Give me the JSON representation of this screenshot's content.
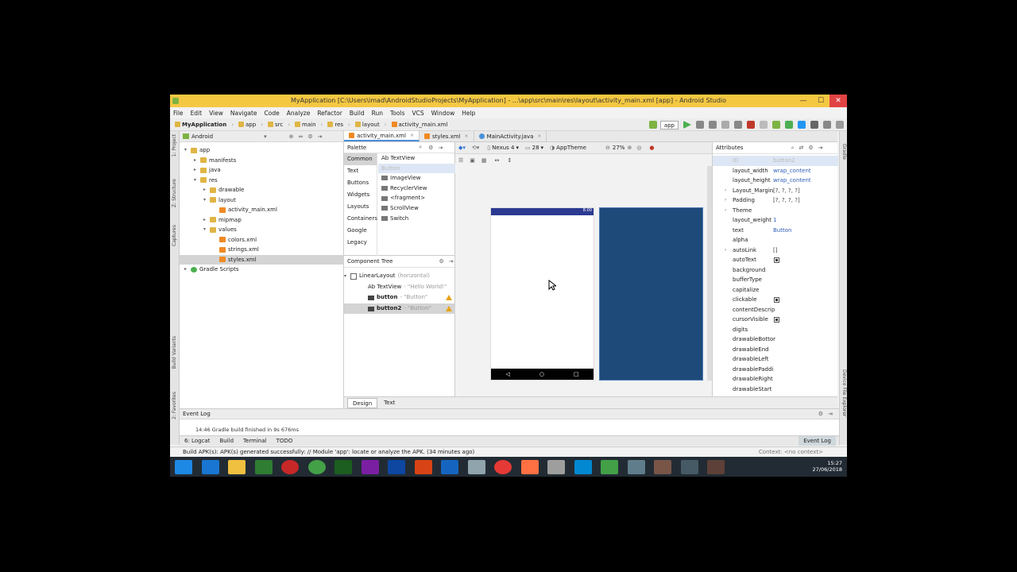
{
  "window": {
    "title": "MyApplication [C:\\Users\\imad\\AndroidStudioProjects\\MyApplication] - ...\\app\\src\\main\\res\\layout\\activity_main.xml [app] - Android Studio",
    "minimize": "—",
    "maximize": "☐",
    "close": "✕"
  },
  "menu": [
    "File",
    "Edit",
    "View",
    "Navigate",
    "Code",
    "Analyze",
    "Refactor",
    "Build",
    "Run",
    "Tools",
    "VCS",
    "Window",
    "Help"
  ],
  "breadcrumb": [
    "MyApplication",
    "app",
    "src",
    "main",
    "res",
    "layout",
    "activity_main.xml"
  ],
  "run_config": "app",
  "project_panel": {
    "view_mode": "Android",
    "tree": [
      {
        "label": "app",
        "indent": 0,
        "arrow": "▾",
        "icon": "folder"
      },
      {
        "label": "manifests",
        "indent": 1,
        "arrow": "▸",
        "icon": "folder"
      },
      {
        "label": "java",
        "indent": 1,
        "arrow": "▸",
        "icon": "folder"
      },
      {
        "label": "res",
        "indent": 1,
        "arrow": "▾",
        "icon": "folder"
      },
      {
        "label": "drawable",
        "indent": 2,
        "arrow": "▸",
        "icon": "folder"
      },
      {
        "label": "layout",
        "indent": 2,
        "arrow": "▾",
        "icon": "folder"
      },
      {
        "label": "activity_main.xml",
        "indent": 3,
        "arrow": "",
        "icon": "xml"
      },
      {
        "label": "mipmap",
        "indent": 2,
        "arrow": "▸",
        "icon": "folder"
      },
      {
        "label": "values",
        "indent": 2,
        "arrow": "▾",
        "icon": "folder"
      },
      {
        "label": "colors.xml",
        "indent": 3,
        "arrow": "",
        "icon": "xml"
      },
      {
        "label": "strings.xml",
        "indent": 3,
        "arrow": "",
        "icon": "xml"
      },
      {
        "label": "styles.xml",
        "indent": 3,
        "arrow": "",
        "icon": "xml"
      },
      {
        "label": "Gradle Scripts",
        "indent": 0,
        "arrow": "▸",
        "icon": "gradle"
      }
    ]
  },
  "left_strip": [
    "1: Project",
    "Z: Structure",
    "Captures",
    "Build Variants",
    "2: Favorites"
  ],
  "right_strip": [
    "Gradle",
    "Device File Explorer"
  ],
  "editor_tabs": [
    {
      "label": "activity_main.xml",
      "icon": "xml",
      "active": true
    },
    {
      "label": "styles.xml",
      "icon": "xml",
      "active": false
    },
    {
      "label": "MainActivity.java",
      "icon": "java",
      "active": false
    }
  ],
  "palette": {
    "title": "Palette",
    "categories": [
      "Common",
      "Text",
      "Buttons",
      "Widgets",
      "Layouts",
      "Containers",
      "Google",
      "Legacy"
    ],
    "items": [
      "Ab TextView",
      "Button",
      "ImageView",
      "RecyclerView",
      "<fragment>",
      "ScrollView",
      "Switch"
    ]
  },
  "component_tree": {
    "title": "Component Tree",
    "rows": [
      {
        "label": "LinearLayout",
        "detail": "(horizontal)",
        "indent": 0,
        "warn": false,
        "bold": false,
        "selected": false
      },
      {
        "label": "Ab TextView",
        "detail": "- \"Hello World!\"",
        "indent": 1,
        "warn": false,
        "bold": false,
        "selected": false
      },
      {
        "label": "button",
        "detail": "- \"Button\"",
        "indent": 1,
        "warn": true,
        "bold": true,
        "selected": false
      },
      {
        "label": "button2",
        "detail": "- \"Button\"",
        "indent": 1,
        "warn": true,
        "bold": true,
        "selected": true
      }
    ]
  },
  "design_toolbar": {
    "device": "Nexus 4",
    "api": "28",
    "theme": "AppTheme",
    "zoom": "27%"
  },
  "phone": {
    "status_time": "8:00"
  },
  "attributes": {
    "title": "Attributes",
    "rows": [
      {
        "name": "ID",
        "value": "button2",
        "type": "id"
      },
      {
        "name": "layout_width",
        "value": "wrap_content",
        "type": "text"
      },
      {
        "name": "layout_height",
        "value": "wrap_content",
        "type": "text"
      },
      {
        "name": "Layout_Margin",
        "value": "[?, ?, ?, ?]",
        "type": "dark",
        "expand": true
      },
      {
        "name": "Padding",
        "value": "[?, ?, ?, ?]",
        "type": "dark",
        "expand": true
      },
      {
        "name": "Theme",
        "value": "",
        "type": "text",
        "expand": true
      },
      {
        "name": "layout_weight",
        "value": "1",
        "type": "text"
      },
      {
        "name": "text",
        "value": "Button",
        "type": "text"
      },
      {
        "name": "alpha",
        "value": "",
        "type": "text"
      },
      {
        "name": "autoLink",
        "value": "[]",
        "type": "dark",
        "expand": true
      },
      {
        "name": "autoText",
        "value": "",
        "type": "check"
      },
      {
        "name": "background",
        "value": "",
        "type": "text"
      },
      {
        "name": "bufferType",
        "value": "",
        "type": "text"
      },
      {
        "name": "capitalize",
        "value": "",
        "type": "text"
      },
      {
        "name": "clickable",
        "value": "",
        "type": "check"
      },
      {
        "name": "contentDescrip",
        "value": "",
        "type": "text"
      },
      {
        "name": "cursorVisible",
        "value": "",
        "type": "check"
      },
      {
        "name": "digits",
        "value": "",
        "type": "text"
      },
      {
        "name": "drawableBottor",
        "value": "",
        "type": "text"
      },
      {
        "name": "drawableEnd",
        "value": "",
        "type": "text"
      },
      {
        "name": "drawableLeft",
        "value": "",
        "type": "text"
      },
      {
        "name": "drawablePaddi",
        "value": "",
        "type": "text"
      },
      {
        "name": "drawableRight",
        "value": "",
        "type": "text"
      },
      {
        "name": "drawableStart",
        "value": "",
        "type": "text"
      }
    ]
  },
  "bottom_tabs": {
    "design": "Design",
    "text": "Text"
  },
  "event_log": {
    "title": "Event Log",
    "line": "14:46   Gradle build finished in 9s 676ms"
  },
  "tool_windows": [
    "6: Logcat",
    "Build",
    "Terminal",
    "TODO"
  ],
  "event_log_button": "Event Log",
  "status": {
    "message": "Build APK(s): APK(s) generated successfully: // Module 'app': locate or analyze the APK. (34 minutes ago)",
    "context": "Context: <no context>"
  },
  "taskbar": {
    "time": "15:27",
    "date": "27/06/2018"
  }
}
